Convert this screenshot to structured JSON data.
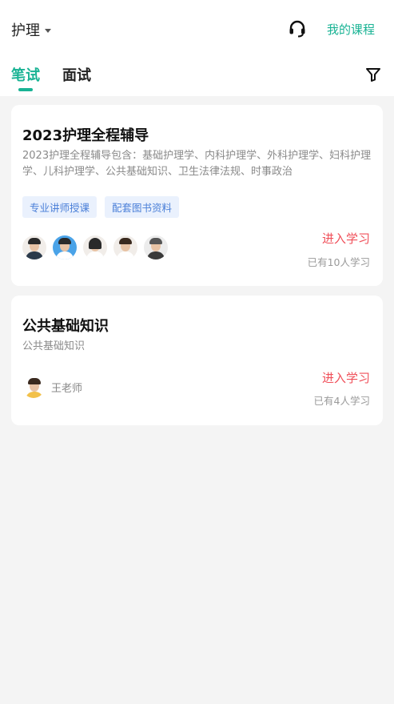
{
  "header": {
    "subject": "护理",
    "my_courses": "我的课程",
    "icons": {
      "support": "headset-icon",
      "subject_dropdown": "caret-down-icon",
      "filter": "filter-icon"
    }
  },
  "tabs": [
    {
      "label": "笔试",
      "active": true
    },
    {
      "label": "面试",
      "active": false
    }
  ],
  "colors": {
    "accent": "#19b394",
    "enter": "#f0505a",
    "tag_bg": "#eaf1fd",
    "tag_text": "#4a7fd8"
  },
  "courses": [
    {
      "title": "2023护理全程辅导",
      "description": "2023护理全程辅导包含：基础护理学、内科护理学、外科护理学、妇科护理学、儿科护理学、公共基础知识、卫生法律法规、时事政治",
      "tags": [
        "专业讲师授课",
        "配套图书资料"
      ],
      "enter_label": "进入学习",
      "learners": "已有10人学习"
    },
    {
      "title": "公共基础知识",
      "description": "公共基础知识",
      "teacher": "王老师",
      "enter_label": "进入学习",
      "learners": "已有4人学习"
    }
  ]
}
